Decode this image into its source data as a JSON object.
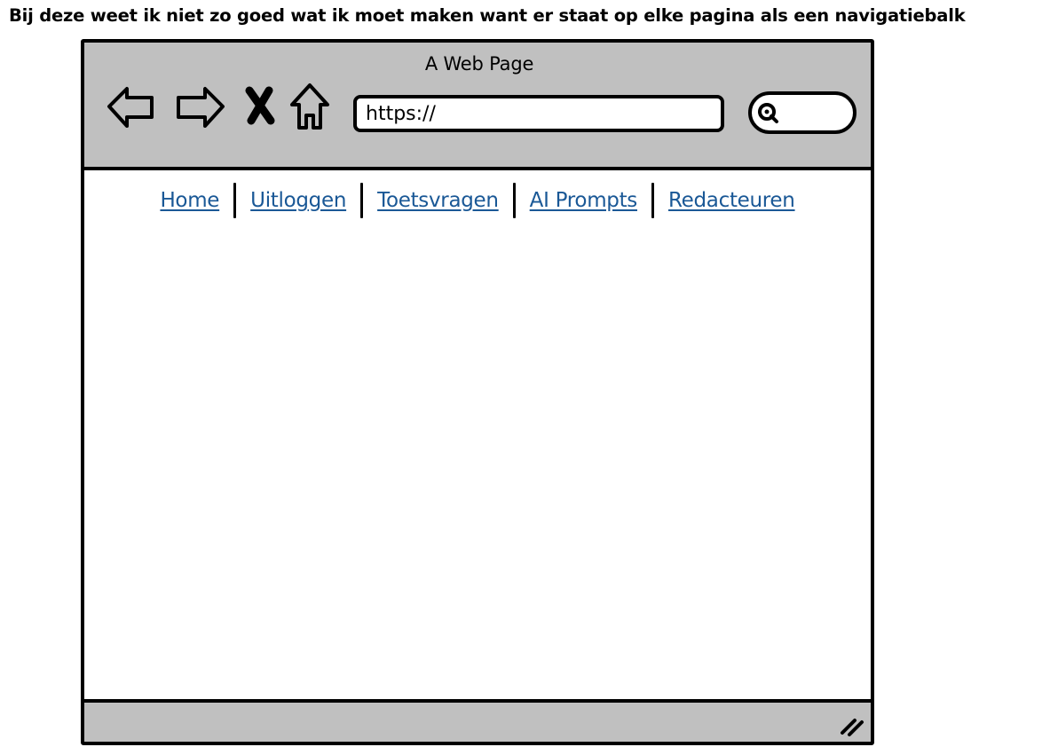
{
  "caption": "Bij deze weet ik niet zo goed wat ik moet maken want er staat op elke pagina als een navigatiebalk",
  "browser": {
    "title": "A Web Page",
    "url": "https://",
    "icons": {
      "back": "arrow-left-icon",
      "forward": "arrow-right-icon",
      "stop": "close-icon",
      "home": "home-icon",
      "search": "search-icon",
      "resize": "resize-grip-icon"
    }
  },
  "navbar": {
    "items": [
      {
        "label": "Home"
      },
      {
        "label": "Uitloggen"
      },
      {
        "label": "Toetsvragen"
      },
      {
        "label": "AI Prompts"
      },
      {
        "label": "Redacteuren"
      }
    ],
    "link_color": "#1a5896"
  },
  "colors": {
    "chrome": "#c0c0c0",
    "border": "#000000",
    "background": "#ffffff"
  }
}
